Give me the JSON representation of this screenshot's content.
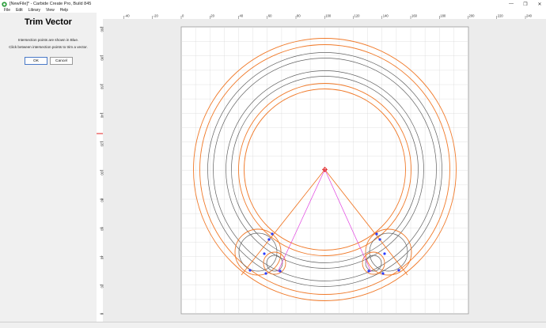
{
  "window": {
    "title": "[NewFile]* - Carbide Create Pro, Build 845",
    "controls": [
      "—",
      "❐",
      "✕"
    ]
  },
  "menu": [
    {
      "label": "File"
    },
    {
      "label": "Edit"
    },
    {
      "label": "Library"
    },
    {
      "label": "View"
    },
    {
      "label": "Help"
    }
  ],
  "panel": {
    "title": "Trim Vector",
    "line1": "Intersection points are shown in Blue.",
    "line2": "Click between intersection points to trim a vector.",
    "ok_label": "OK",
    "cancel_label": "Cancel"
  },
  "ruler": {
    "x_labels": [
      "-40",
      "-20",
      "0",
      "20",
      "40",
      "60",
      "80",
      "100",
      "120",
      "140",
      "160",
      "180",
      "200",
      "220",
      "240"
    ],
    "y_labels": [
      "200",
      "180",
      "160",
      "140",
      "120",
      "100",
      "80",
      "60",
      "40",
      "20",
      "0"
    ]
  },
  "colors": {
    "orange": "#f07a2a",
    "gray": "#606060",
    "magenta": "#e040e0",
    "blue": "#2a3cff",
    "red": "#e02020",
    "grid": "#d8d8d8"
  }
}
